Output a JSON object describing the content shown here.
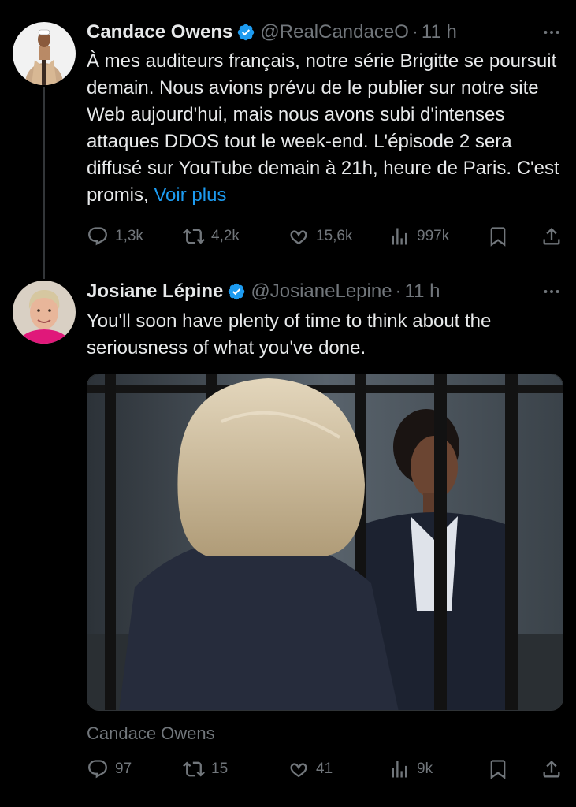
{
  "tweets": [
    {
      "author_name": "Candace Owens",
      "handle": "@RealCandaceO",
      "separator": "·",
      "time": "11 h",
      "verified_color": "#1d9bf0",
      "text": "À mes auditeurs français, notre série Brigitte se poursuit demain. Nous avions prévu de le publier sur notre site Web aujourd'hui, mais nous avons subi d'intenses attaques DDOS tout le week-end. L'épisode 2 sera diffusé sur YouTube demain à 21h, heure de Paris. C'est promis,",
      "more_link": "Voir plus",
      "replies": "1,3k",
      "reposts": "4,2k",
      "likes": "15,6k",
      "views": "997k"
    },
    {
      "author_name": "Josiane Lépine",
      "handle": "@JosianeLepine",
      "separator": "·",
      "time": "11 h",
      "verified_color": "#1d9bf0",
      "text": "You'll soon have plenty of time to think about the seriousness of what you've done.",
      "media_attribution": "Candace Owens",
      "replies": "97",
      "reposts": "15",
      "likes": "41",
      "views": "9k"
    }
  ],
  "icons": {
    "more": "more-horizontal-icon",
    "reply": "reply-icon",
    "repost": "repost-icon",
    "like": "heart-icon",
    "views": "views-chart-icon",
    "bookmark": "bookmark-icon",
    "share": "share-icon"
  },
  "colors": {
    "background": "#000000",
    "text": "#e7e9ea",
    "secondary": "#71767b",
    "link": "#1d9bf0"
  }
}
